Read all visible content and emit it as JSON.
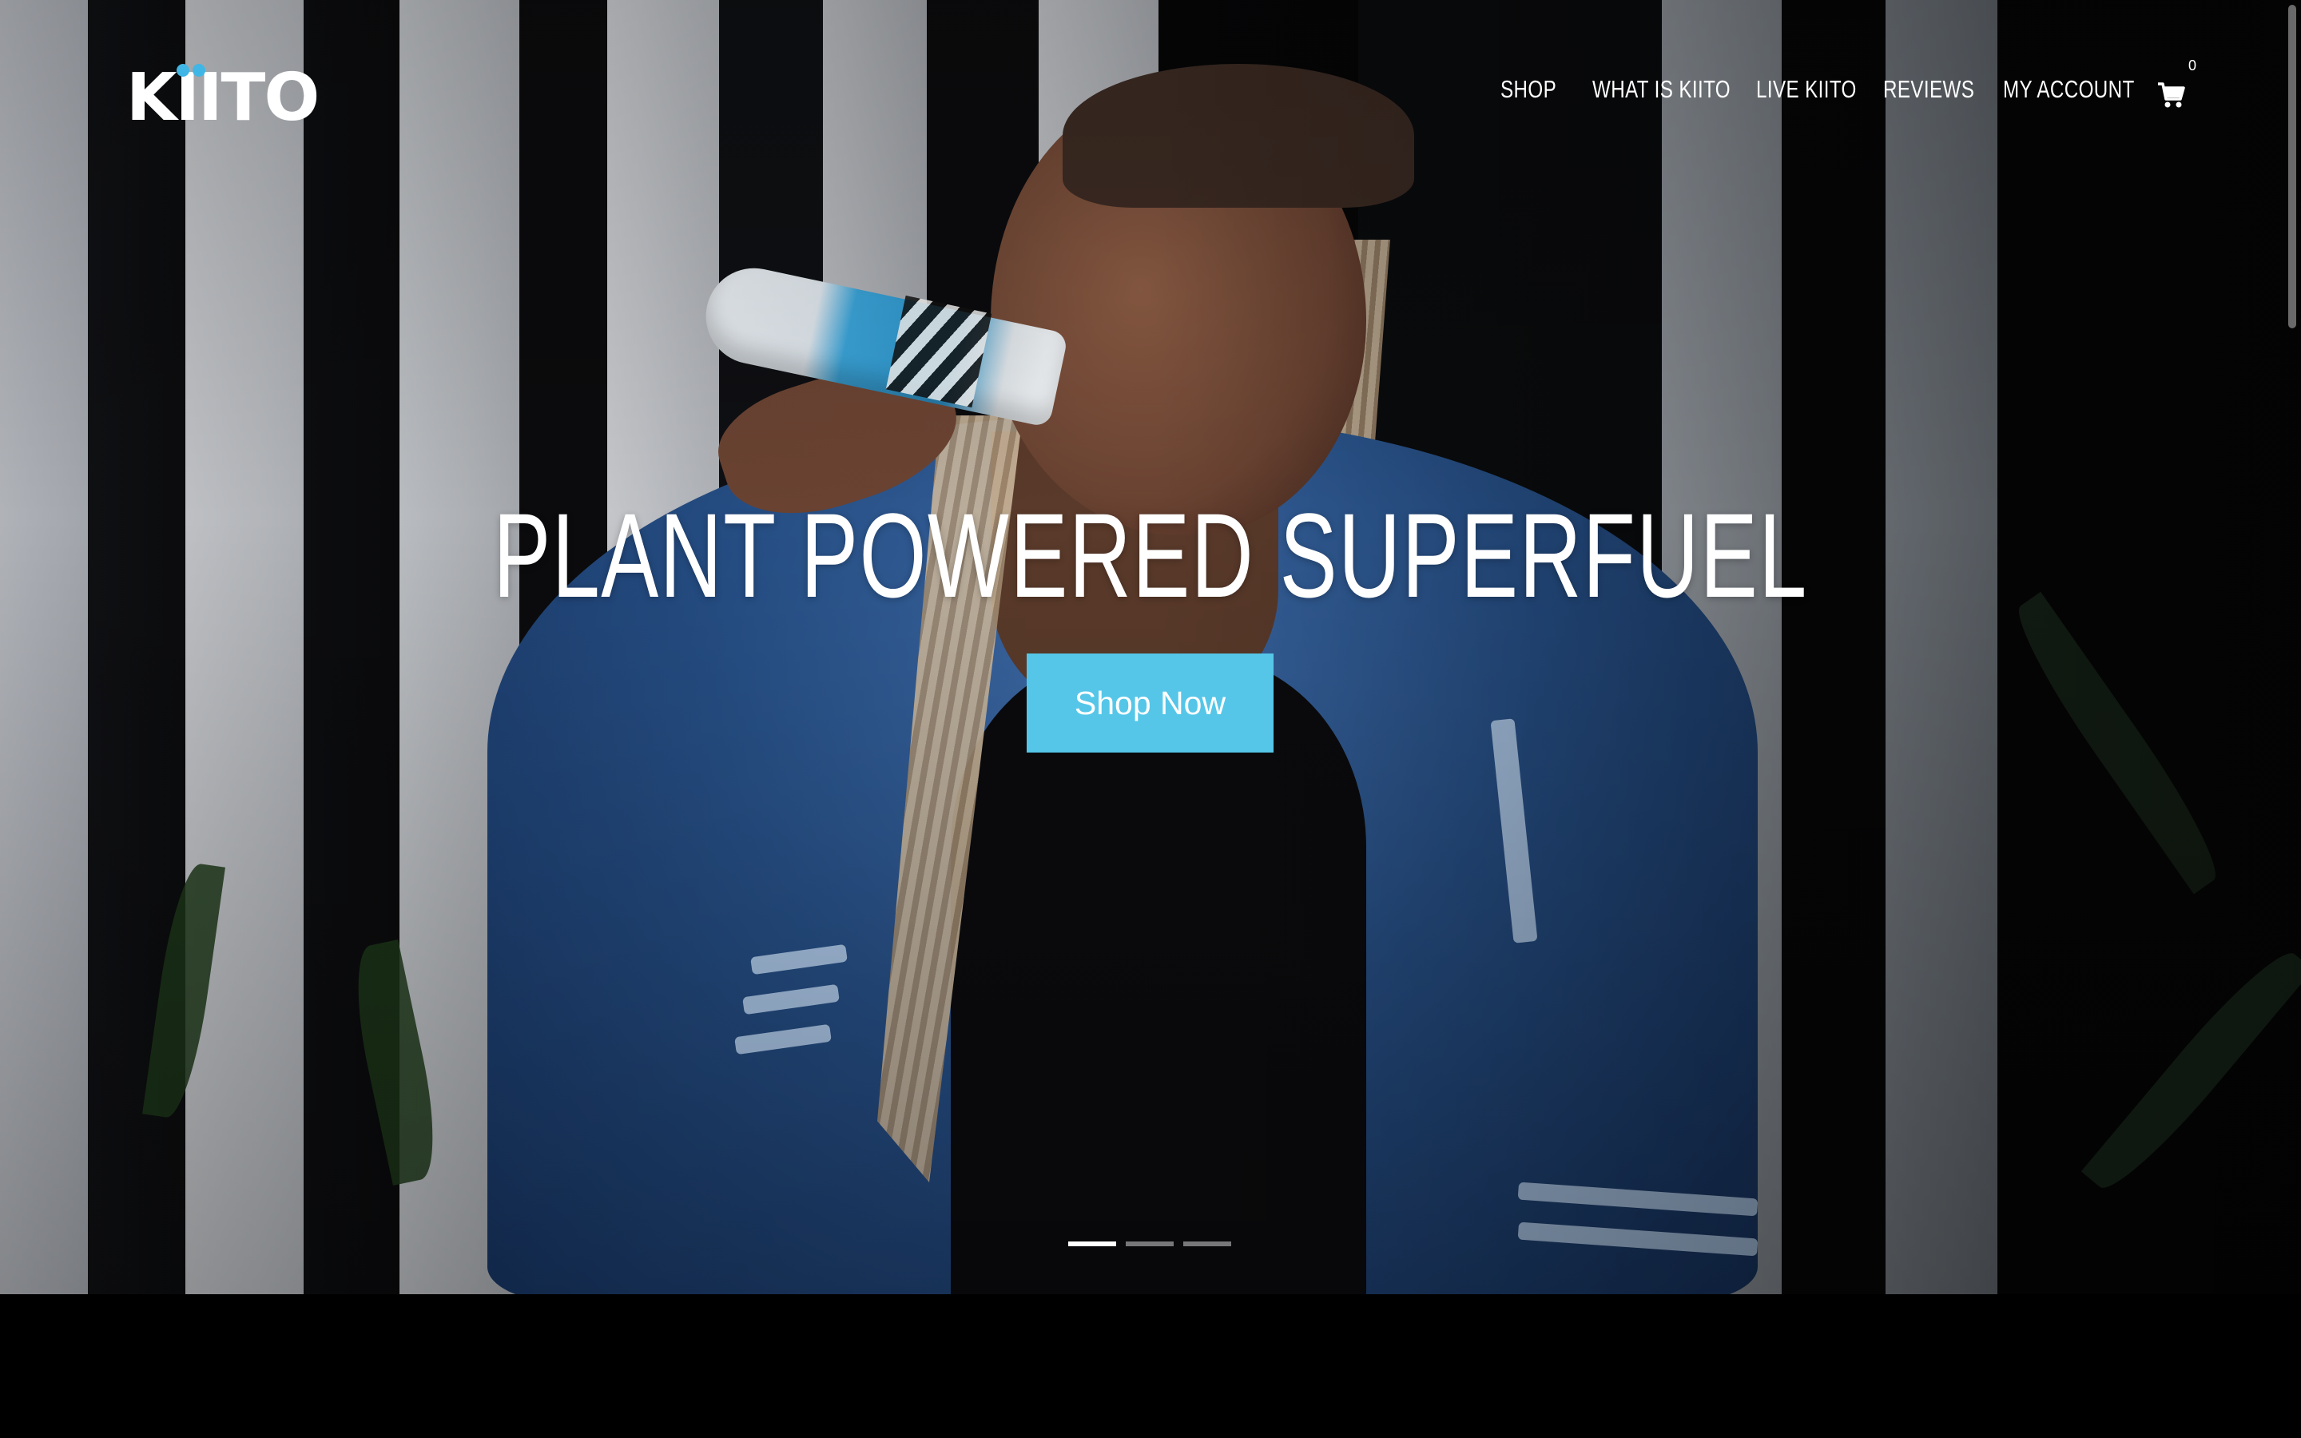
{
  "brand": {
    "logo_text": "KIITO",
    "accent_color": "#3fb6e6"
  },
  "nav": {
    "items": [
      {
        "label": "SHOP"
      },
      {
        "label": "WHAT IS KIITO"
      },
      {
        "label": "LIVE KIITO"
      },
      {
        "label": "REVIEWS"
      },
      {
        "label": "MY ACCOUNT"
      }
    ],
    "cart": {
      "icon": "shopping-cart-icon",
      "count": "0"
    }
  },
  "hero": {
    "headline": "PLANT POWERED SUPERFUEL",
    "cta_label": "Shop Now",
    "cta_color": "#55c6e8",
    "slides": {
      "total": 3,
      "active_index": 0
    }
  }
}
